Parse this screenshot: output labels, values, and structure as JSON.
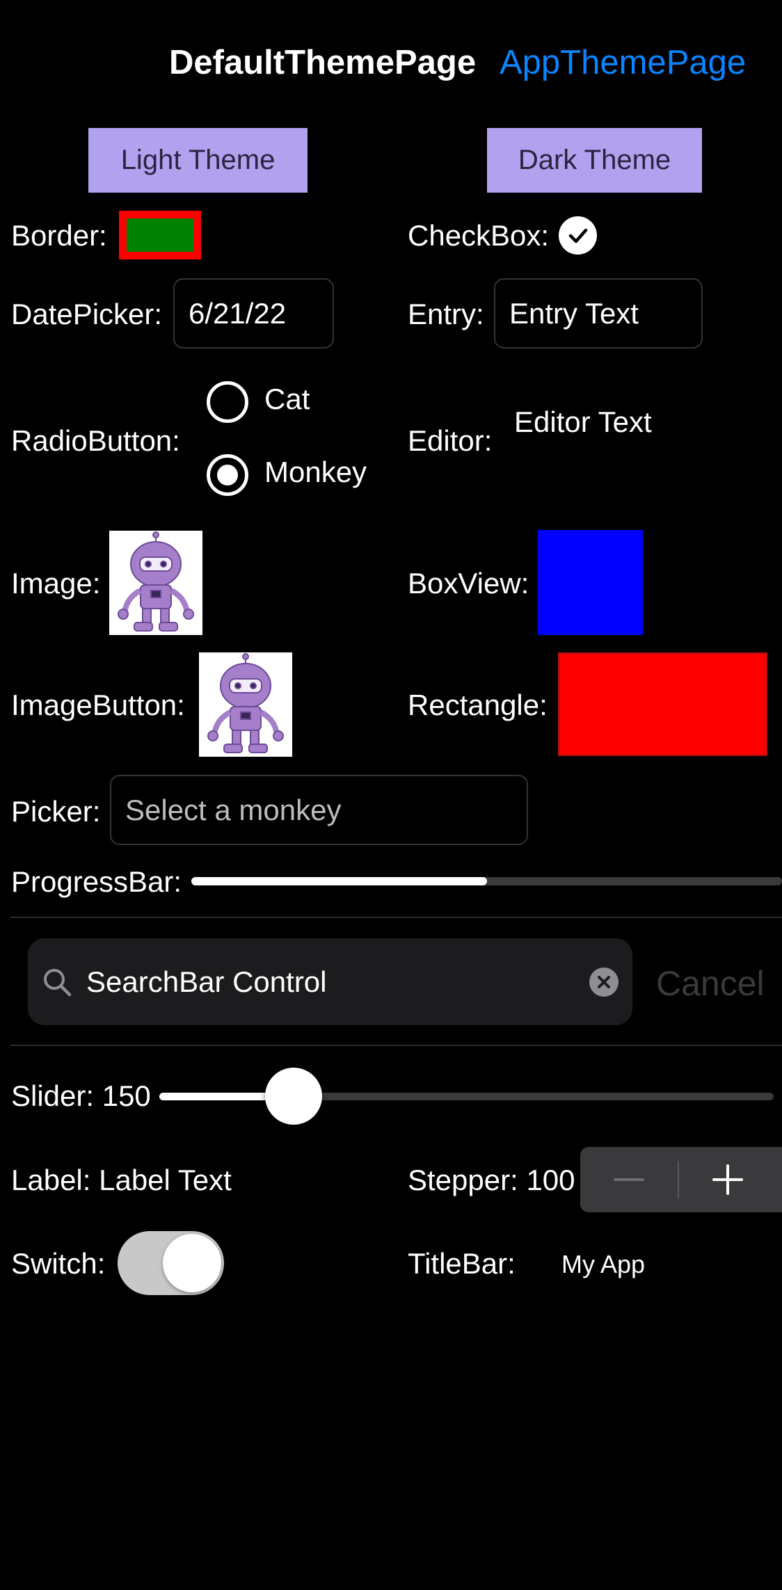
{
  "nav": {
    "current": "DefaultThemePage",
    "link": "AppThemePage"
  },
  "theme_buttons": {
    "light": "Light Theme",
    "dark": "Dark Theme"
  },
  "labels": {
    "border": "Border:",
    "checkbox": "CheckBox:",
    "datepicker": "DatePicker:",
    "entry": "Entry:",
    "radiobutton": "RadioButton:",
    "editor": "Editor:",
    "image": "Image:",
    "boxview": "BoxView:",
    "imagebutton": "ImageButton:",
    "rectangle": "Rectangle:",
    "picker": "Picker:",
    "progressbar": "ProgressBar:",
    "slider": "Slider: 150",
    "label": "Label: Label Text",
    "stepper": "Stepper: 100",
    "switch": "Switch:",
    "titlebar": "TitleBar:"
  },
  "values": {
    "date": "6/21/22",
    "entry_text": "Entry Text",
    "editor_text": "Editor Text",
    "picker_placeholder": "Select a monkey",
    "search_text": "SearchBar Control",
    "search_cancel": "Cancel",
    "titlebar_text": "My App",
    "radio_options": [
      "Cat",
      "Monkey"
    ],
    "radio_selected": "Monkey",
    "checkbox_checked": true,
    "switch_on": true,
    "progress": 0.5,
    "slider_value": 150
  },
  "colors": {
    "theme_button_bg": "#b2a1ef",
    "border_stroke": "#ff0000",
    "border_fill": "#008000",
    "boxview": "#0000ff",
    "rectangle": "#ff0000",
    "nav_link": "#0a84ff"
  }
}
